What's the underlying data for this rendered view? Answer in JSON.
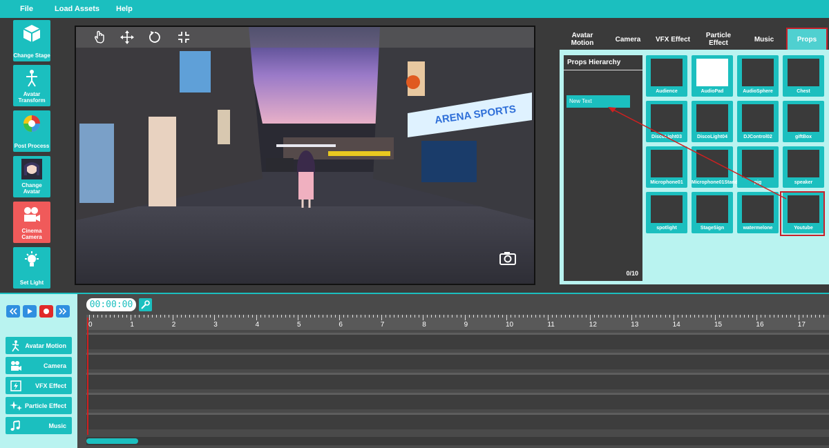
{
  "menu": [
    "File",
    "Load Assets",
    "Help"
  ],
  "tools": [
    {
      "label": "Change Stage",
      "icon": "cube-icon"
    },
    {
      "label": "Avatar Transform",
      "icon": "person-icon"
    },
    {
      "label": "Post Process",
      "icon": "color-wheel-icon"
    },
    {
      "label": "Change Avatar",
      "icon": "avatar-portrait-icon"
    },
    {
      "label": "Cinema Camera",
      "icon": "video-camera-icon"
    },
    {
      "label": "Set Light",
      "icon": "lightbulb-icon"
    }
  ],
  "viewport_tools": [
    "hand-icon",
    "move-icon",
    "rotate-icon",
    "scale-icon"
  ],
  "scene": {
    "sign_text": "ARENA SPORTS"
  },
  "tabs": [
    {
      "label": "Avatar Motion"
    },
    {
      "label": "Camera"
    },
    {
      "label": "VFX Effect"
    },
    {
      "label": "Particle Effect"
    },
    {
      "label": "Music"
    },
    {
      "label": "Props",
      "selected": true
    }
  ],
  "hierarchy": {
    "title": "Props Hierarchy",
    "item": "New Text",
    "count": "0/10"
  },
  "props": [
    "Audience",
    "AudioPad",
    "AudioSphere",
    "Chest",
    "DiscoLight03",
    "DiscoLight04",
    "DJControl02",
    "giftBox",
    "Microphone01",
    "Microphone01Stand",
    "pig",
    "speaker",
    "spotlight",
    "StageSign",
    "watermelone",
    "Youtube"
  ],
  "timeline": {
    "timecode": "00:00:00",
    "ruler": [
      "0",
      "1",
      "2",
      "3",
      "4",
      "5",
      "6",
      "7",
      "8",
      "9",
      "10",
      "11",
      "12",
      "13",
      "14",
      "15",
      "16",
      "17"
    ]
  },
  "tracks": [
    {
      "label": "Avatar Motion",
      "icon": "avatar-motion-icon"
    },
    {
      "label": "Camera",
      "icon": "camera-icon"
    },
    {
      "label": "VFX Effect",
      "icon": "vfx-icon"
    },
    {
      "label": "Particle Effect",
      "icon": "sparkle-icon"
    },
    {
      "label": "Music",
      "icon": "music-note-icon"
    }
  ],
  "colors": {
    "accent": "#1bbfbf",
    "active": "#f05a5a",
    "highlight": "#c8202a"
  }
}
